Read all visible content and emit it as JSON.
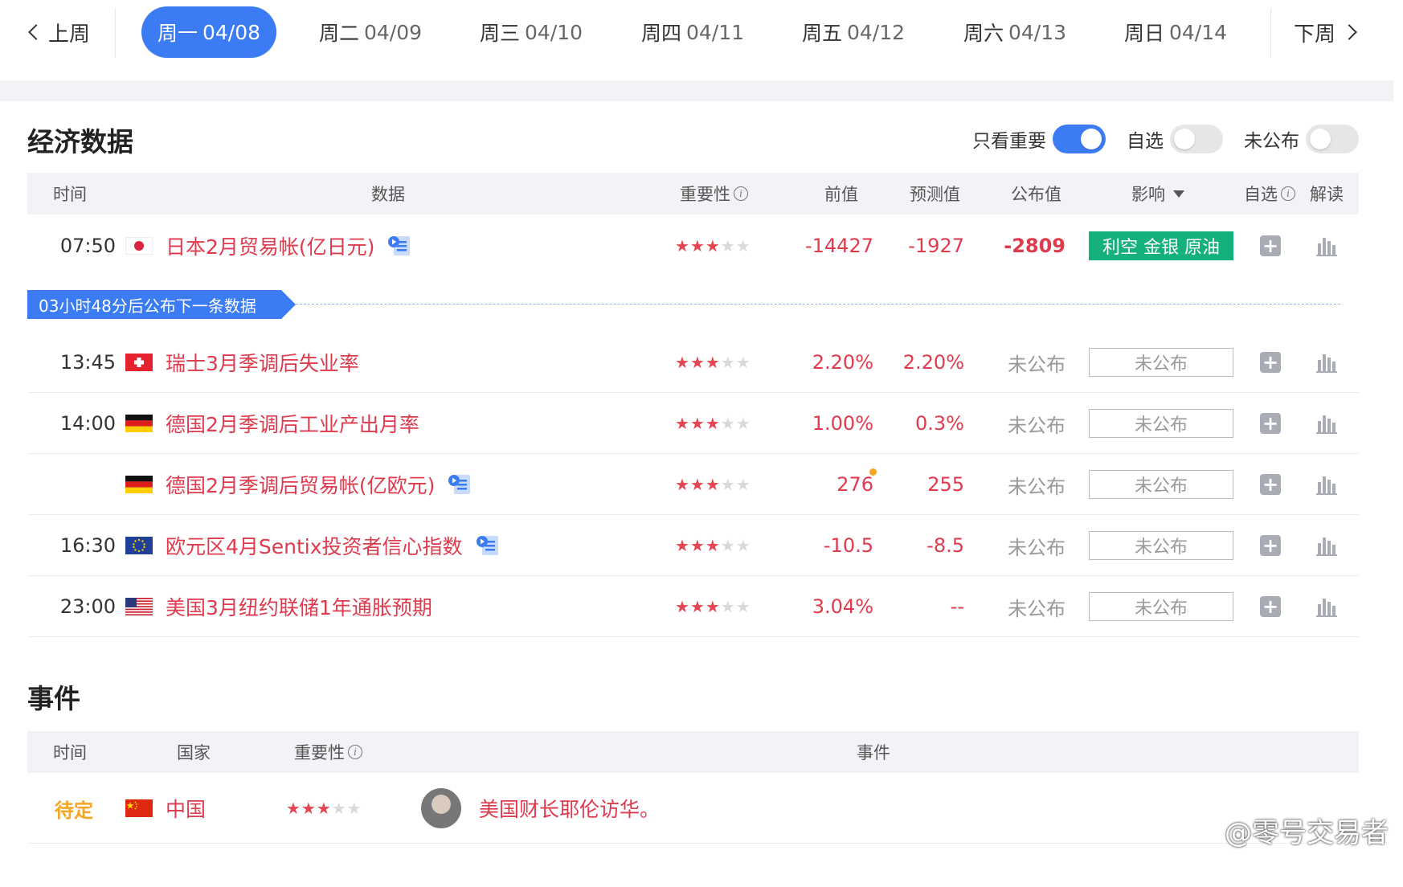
{
  "week_nav": {
    "prev_label": "上周",
    "next_label": "下周",
    "days": [
      {
        "weekday": "周一",
        "date": "04/08",
        "active": true
      },
      {
        "weekday": "周二",
        "date": "04/09",
        "active": false
      },
      {
        "weekday": "周三",
        "date": "04/10",
        "active": false
      },
      {
        "weekday": "周四",
        "date": "04/11",
        "active": false
      },
      {
        "weekday": "周五",
        "date": "04/12",
        "active": false
      },
      {
        "weekday": "周六",
        "date": "04/13",
        "active": false
      },
      {
        "weekday": "周日",
        "date": "04/14",
        "active": false
      }
    ]
  },
  "econ": {
    "title": "经济数据",
    "toggles": [
      {
        "label": "只看重要",
        "on": true
      },
      {
        "label": "自选",
        "on": false
      },
      {
        "label": "未公布",
        "on": false
      }
    ],
    "columns": {
      "time": "时间",
      "data": "数据",
      "importance": "重要性",
      "previous": "前值",
      "forecast": "预测值",
      "actual": "公布值",
      "impact": "影响",
      "watch": "自选",
      "analysis": "解读"
    },
    "countdown": "03小时48分后公布下一条数据",
    "rows": [
      {
        "time": "07:50",
        "flag": "japan",
        "name": "日本2月贸易帐(亿日元)",
        "has_doc": true,
        "stars": 3,
        "previous": "-14427",
        "forecast": "-1927",
        "actual": "-2809",
        "impact": "利空 金银 原油"
      },
      {
        "time": "13:45",
        "flag": "switzerland",
        "name": "瑞士3月季调后失业率",
        "has_doc": false,
        "stars": 3,
        "previous": "2.20%",
        "forecast": "2.20%",
        "actual": "未公布",
        "impact": "未公布"
      },
      {
        "time": "14:00",
        "flag": "germany",
        "name": "德国2月季调后工业产出月率",
        "has_doc": false,
        "stars": 3,
        "previous": "1.00%",
        "forecast": "0.3%",
        "actual": "未公布",
        "impact": "未公布"
      },
      {
        "time": "",
        "flag": "germany",
        "name": "德国2月季调后贸易帐(亿欧元)",
        "has_doc": true,
        "stars": 3,
        "previous": "276",
        "forecast": "255",
        "actual": "未公布",
        "impact": "未公布"
      },
      {
        "time": "16:30",
        "flag": "eu",
        "name": "欧元区4月Sentix投资者信心指数",
        "has_doc": true,
        "stars": 3,
        "previous": "-10.5",
        "forecast": "-8.5",
        "actual": "未公布",
        "impact": "未公布"
      },
      {
        "time": "23:00",
        "flag": "usa",
        "name": "美国3月纽约联储1年通胀预期",
        "has_doc": false,
        "stars": 3,
        "previous": "3.04%",
        "forecast": "--",
        "actual": "未公布",
        "impact": "未公布"
      }
    ]
  },
  "events": {
    "title": "事件",
    "columns": {
      "time": "时间",
      "country": "国家",
      "importance": "重要性",
      "event": "事件"
    },
    "rows": [
      {
        "time": "待定",
        "flag": "china",
        "country": "中国",
        "stars": 3,
        "event": "美国财长耶伦访华。"
      }
    ]
  },
  "watermark": "@零号交易者",
  "colors": {
    "accent": "#3b7cf5",
    "red": "#e03a4d",
    "green_badge": "#14b17a",
    "pending": "#f5a623"
  }
}
